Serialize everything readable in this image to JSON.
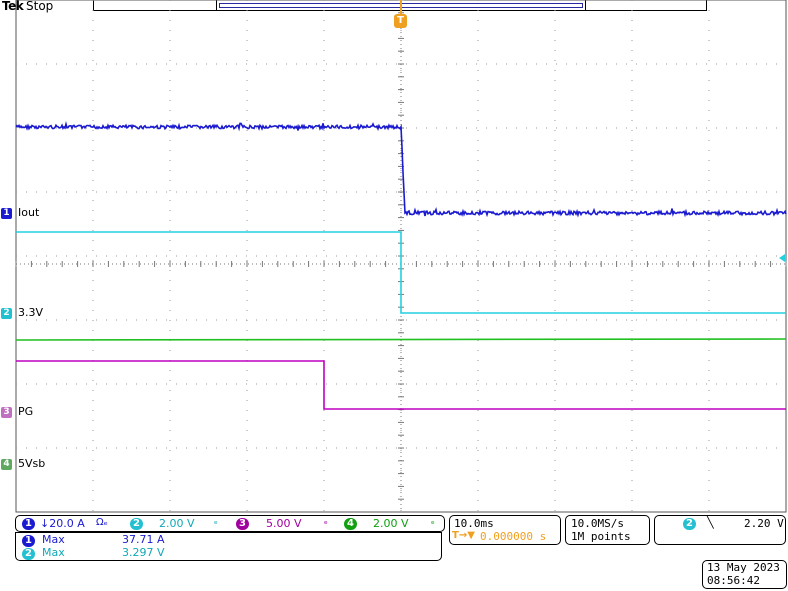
{
  "header": {
    "brand": "Tek",
    "status": "Stop"
  },
  "colors": {
    "ch1": "#1a1ad0",
    "ch2": "#22d0e0",
    "ch3": "#c000c0",
    "ch4": "#20c020",
    "trigger": "#f0a020",
    "grid": "#9a9a9a"
  },
  "trigger_marker": "T",
  "channels": [
    {
      "num": "1",
      "label": "Iout"
    },
    {
      "num": "2",
      "label": "3.3V"
    },
    {
      "num": "3",
      "label": "PG"
    },
    {
      "num": "4",
      "label": "5Vsb"
    }
  ],
  "vertical_settings": {
    "ch1": {
      "num": "1",
      "value": "↓20.0 A",
      "coupling": "Ωₑ"
    },
    "ch2": {
      "num": "2",
      "value": "2.00 V",
      "coupling": "ₑ"
    },
    "ch3": {
      "num": "3",
      "value": "5.00 V",
      "coupling": "ₑ"
    },
    "ch4": {
      "num": "4",
      "value": "2.00 V",
      "coupling": "ₑ"
    }
  },
  "measurements": [
    {
      "num": "1",
      "name": "Max",
      "value": "37.71 A"
    },
    {
      "num": "2",
      "name": "Max",
      "value": "3.297 V"
    }
  ],
  "timebase": {
    "scale": "10.0ms",
    "trigger_icon": "T→▼",
    "position": "0.000000 s"
  },
  "acquisition": {
    "rate": "10.0MS/s",
    "points": "1M points"
  },
  "trigger": {
    "source": "2",
    "slope": "╲",
    "level": "2.20 V"
  },
  "timestamp": {
    "date": "13 May 2023",
    "time": "08:56:42"
  }
}
